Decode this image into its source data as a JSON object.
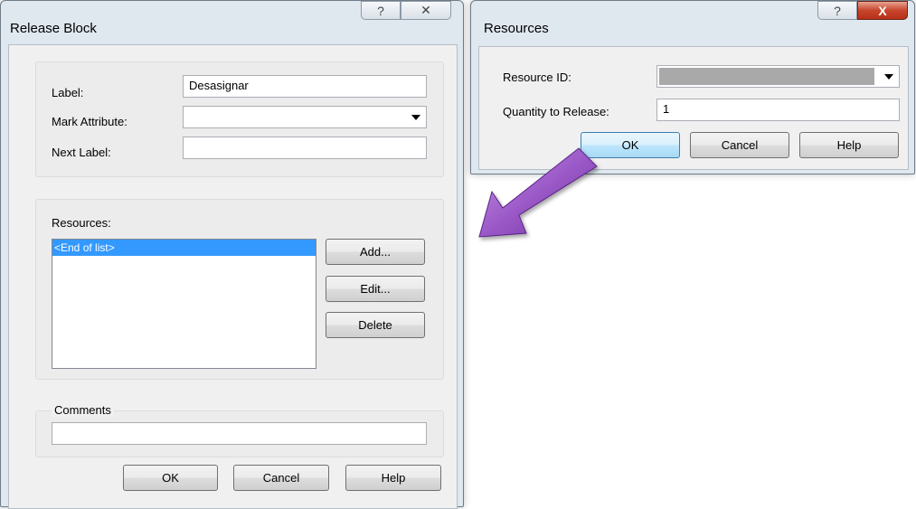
{
  "release_dialog": {
    "title": "Release Block",
    "help_glyph": "?",
    "close_glyph": "✕",
    "label_caption": "Label:",
    "label_value": "Desasignar",
    "mark_attribute_caption": "Mark Attribute:",
    "mark_attribute_value": "",
    "next_label_caption": "Next Label:",
    "next_label_value": "",
    "resources_caption": "Resources:",
    "resources_items": [
      "<End of list>"
    ],
    "add_label": "Add...",
    "edit_label": "Edit...",
    "delete_label": "Delete",
    "comments_caption": "Comments",
    "comments_value": "",
    "ok_label": "OK",
    "cancel_label": "Cancel",
    "help_label": "Help"
  },
  "resources_dialog": {
    "title": "Resources",
    "help_glyph": "?",
    "close_glyph": "X",
    "resource_id_caption": "Resource ID:",
    "resource_id_value": "",
    "quantity_caption": "Quantity to Release:",
    "quantity_value": "1",
    "ok_label": "OK",
    "cancel_label": "Cancel",
    "help_label": "Help"
  },
  "colors": {
    "arrow_fill": "#9b59c8",
    "selection": "#3399ff",
    "dialog_frame": "#dfe7ef"
  }
}
